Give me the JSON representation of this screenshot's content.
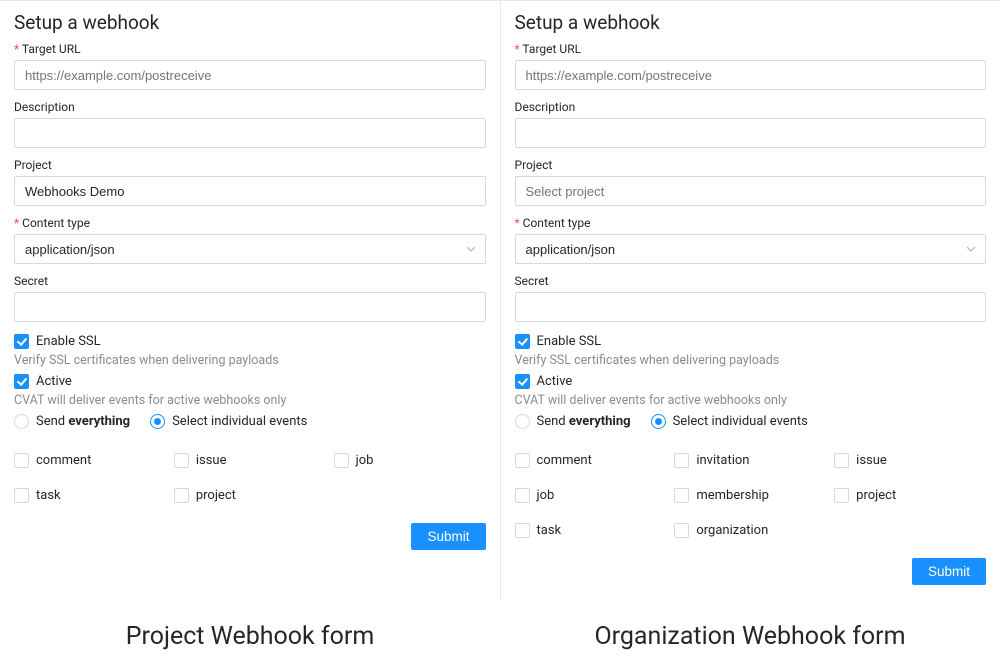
{
  "left": {
    "title": "Setup a webhook",
    "target": {
      "label": "Target URL",
      "placeholder": "https://example.com/postreceive",
      "value": ""
    },
    "description": {
      "label": "Description",
      "value": ""
    },
    "project": {
      "label": "Project",
      "value": "Webhooks Demo",
      "placeholder": ""
    },
    "content_type": {
      "label": "Content type",
      "value": "application/json"
    },
    "secret": {
      "label": "Secret",
      "value": ""
    },
    "ssl": {
      "label": "Enable SSL",
      "checked": true,
      "help": "Verify SSL certificates when delivering payloads"
    },
    "active": {
      "label": "Active",
      "checked": true,
      "help": "CVAT will deliver events for active webhooks only"
    },
    "scope": {
      "everything_prefix": "Send ",
      "everything_strong": "everything",
      "individual": "Select individual events",
      "selected": "individual"
    },
    "events": [
      "comment",
      "issue",
      "job",
      "task",
      "project"
    ],
    "submit": "Submit",
    "caption": "Project Webhook form"
  },
  "right": {
    "title": "Setup a webhook",
    "target": {
      "label": "Target URL",
      "placeholder": "https://example.com/postreceive",
      "value": ""
    },
    "description": {
      "label": "Description",
      "value": ""
    },
    "project": {
      "label": "Project",
      "value": "",
      "placeholder": "Select project"
    },
    "content_type": {
      "label": "Content type",
      "value": "application/json"
    },
    "secret": {
      "label": "Secret",
      "value": ""
    },
    "ssl": {
      "label": "Enable SSL",
      "checked": true,
      "help": "Verify SSL certificates when delivering payloads"
    },
    "active": {
      "label": "Active",
      "checked": true,
      "help": "CVAT will deliver events for active webhooks only"
    },
    "scope": {
      "everything_prefix": "Send ",
      "everything_strong": "everything",
      "individual": "Select individual events",
      "selected": "individual"
    },
    "events": [
      "comment",
      "invitation",
      "issue",
      "job",
      "membership",
      "project",
      "task",
      "organization"
    ],
    "submit": "Submit",
    "caption": "Organization Webhook form"
  }
}
